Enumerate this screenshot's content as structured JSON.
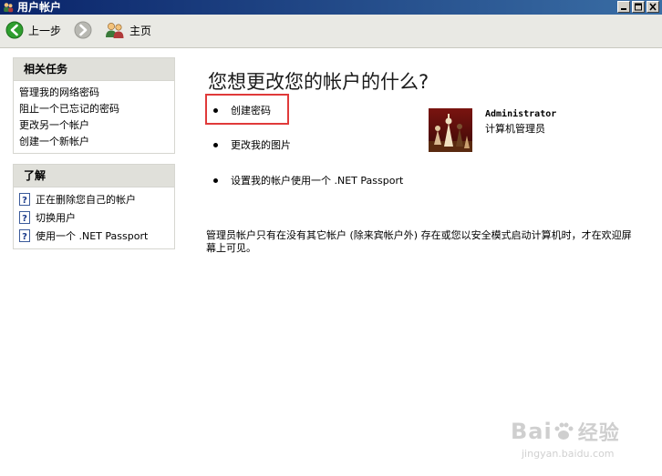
{
  "window": {
    "title": "用户帐户"
  },
  "toolbar": {
    "back_label": "上一步",
    "home_label": "主页"
  },
  "related_tasks": {
    "heading": "相关任务",
    "items": [
      "管理我的网络密码",
      "阻止一个已忘记的密码",
      "更改另一个帐户",
      "创建一个新帐户"
    ]
  },
  "learn": {
    "heading": "了解",
    "items": [
      "正在删除您自己的帐户",
      "切换用户",
      "使用一个 .NET Passport"
    ]
  },
  "main": {
    "title": "您想更改您的帐户的什么?",
    "options": [
      "创建密码",
      "更改我的图片",
      "设置我的帐户使用一个 .NET Passport"
    ],
    "note": "管理员帐户只有在没有其它帐户 (除来宾帐户外) 存在或您以安全模式启动计算机时，才在欢迎屏幕上可见。"
  },
  "account": {
    "name": "Administrator",
    "type": "计算机管理员"
  },
  "watermark": {
    "logo_prefix": "Bai",
    "logo_suffix": "经验",
    "url": "jingyan.baidu.com"
  },
  "colors": {
    "highlight": "#e03a3a",
    "titlebar": "#0a246a",
    "back_arrow": "#2e9e2e"
  }
}
